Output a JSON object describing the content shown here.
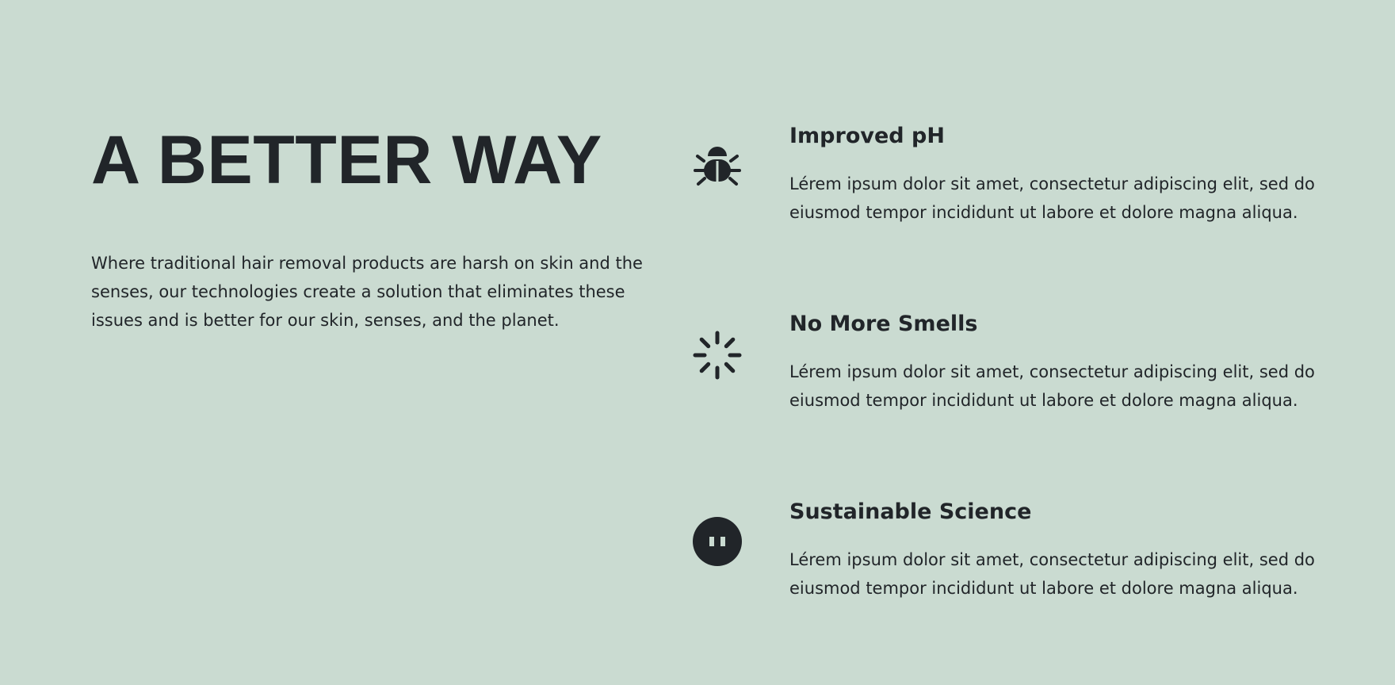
{
  "hero": {
    "title": "A BETTER WAY",
    "description": "Where traditional hair removal products are harsh on skin and the senses, our technologies create a solution that eliminates these issues and is better for our skin, senses, and the planet."
  },
  "features": [
    {
      "icon": "bug-icon",
      "title": "Improved pH",
      "text": "Lérem ipsum dolor sit amet, consectetur adipiscing elit, sed do eiusmod tempor incididunt ut labore et dolore magna aliqua."
    },
    {
      "icon": "loading-spinner-icon",
      "title": "No More Smells",
      "text": "Lérem ipsum dolor sit amet, consectetur adipiscing elit, sed do eiusmod tempor incididunt ut labore et dolore magna aliqua."
    },
    {
      "icon": "plug-icon",
      "title": "Sustainable Science",
      "text": "Lérem ipsum dolor sit amet, consectetur adipiscing elit, sed do eiusmod tempor incididunt ut labore et dolore magna aliqua."
    }
  ],
  "colors": {
    "background": "#cadbd1",
    "text": "#212529"
  }
}
